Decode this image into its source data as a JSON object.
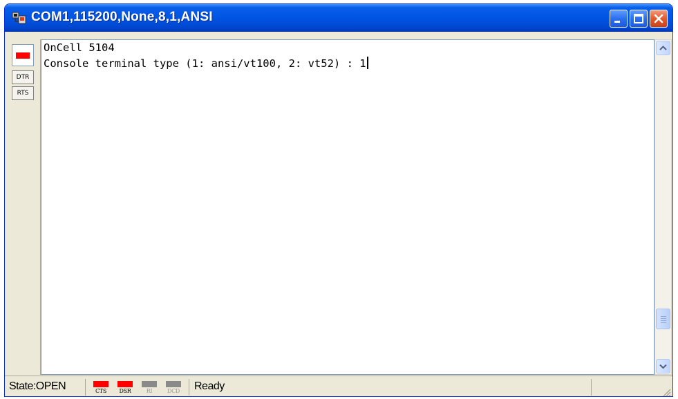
{
  "window": {
    "title": "COM1,115200,None,8,1,ANSI"
  },
  "terminal": {
    "lines": [
      "OnCell 5104",
      "Console terminal type (1: ansi/vt100, 2: vt52) : 1"
    ]
  },
  "left_panel": {
    "buttons": [
      "DTR",
      "RTS"
    ]
  },
  "statusbar": {
    "state": "State:OPEN",
    "indicators": [
      {
        "label": "CTS",
        "active": true
      },
      {
        "label": "DSR",
        "active": true
      },
      {
        "label": "RI",
        "active": false
      },
      {
        "label": "DCD",
        "active": false
      }
    ],
    "message": "Ready"
  },
  "colors": {
    "led_on": "#ff0000",
    "led_off": "#8a8a8a",
    "title_bar": "#0054e3"
  }
}
